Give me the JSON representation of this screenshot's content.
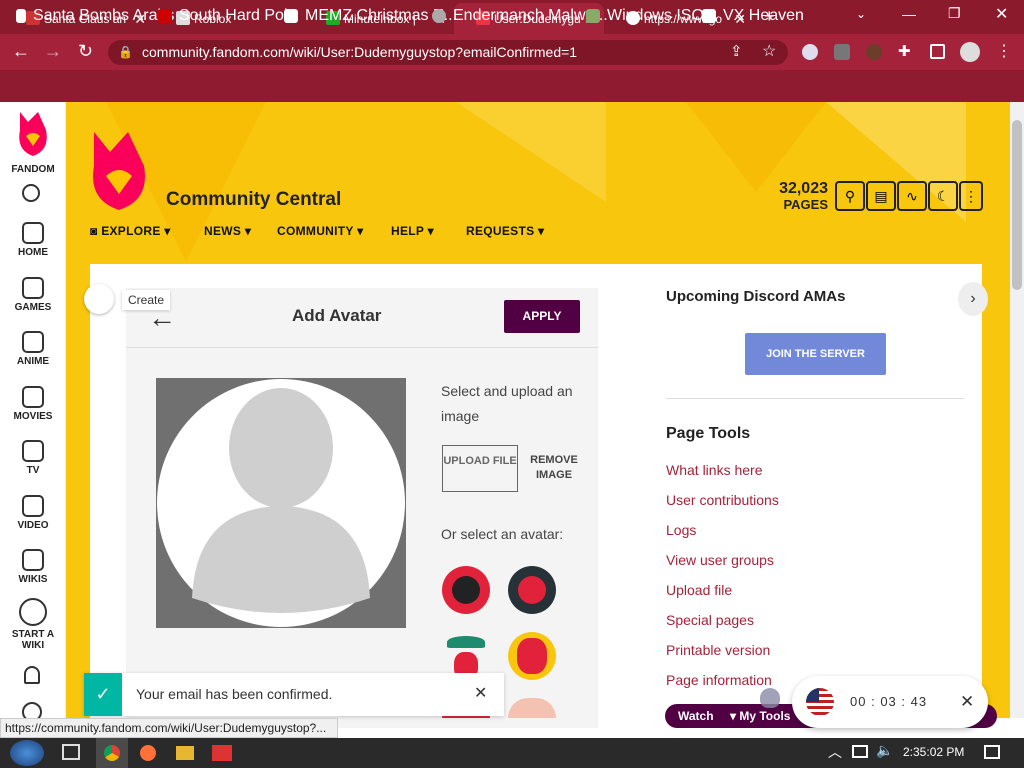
{
  "browser": {
    "tabs": [
      {
        "title": "Santa Claus an",
        "active": false
      },
      {
        "title": "Roblox",
        "active": false
      },
      {
        "title": "MinuteInbox |",
        "active": false
      },
      {
        "title": "User:Dudemygu",
        "active": true
      },
      {
        "title": "https://www.go",
        "active": false
      }
    ],
    "url": "community.fandom.com/wiki/User:Dudemyguystop?emailConfirmed=1",
    "bookmarks": [
      "Santa Bombs Arabs",
      "South Hard Pole",
      "MEMZ Christmas E...",
      "Endermanch Malwa...",
      "Windows ISOs",
      "VX Heaven"
    ]
  },
  "sidebar": {
    "brand": "FANDOM",
    "items": [
      "HOME",
      "GAMES",
      "ANIME",
      "MOVIES",
      "TV",
      "VIDEO",
      "WIKIS",
      "START A WIKI"
    ]
  },
  "wiki": {
    "name": "Community Central",
    "pages_count": "32,023",
    "pages_label": "PAGES",
    "nav": [
      "EXPLORE",
      "NEWS",
      "COMMUNITY",
      "HELP",
      "REQUESTS"
    ]
  },
  "avatar_dialog": {
    "tooltip": "Create",
    "title": "Add Avatar",
    "apply": "APPLY",
    "select_text": "Select and upload an image",
    "upload": "UPLOAD FILE",
    "remove": "REMOVE IMAGE",
    "or_select": "Or select an avatar:"
  },
  "right_rail": {
    "discord_title": "Upcoming Discord AMAs",
    "join": "JOIN THE SERVER",
    "page_tools_title": "Page Tools",
    "links": [
      "What links here",
      "User contributions",
      "Logs",
      "View user groups",
      "Upload file",
      "Special pages",
      "Printable version",
      "Page information"
    ]
  },
  "toast": {
    "message": "Your email has been confirmed."
  },
  "timer": {
    "h": "00",
    "m": "03",
    "s": "43"
  },
  "bottom_bar": {
    "watch": "Watch",
    "my_tools": "My Tools"
  },
  "status_url": "https://community.fandom.com/wiki/User:Dudemyguystop?...",
  "clock": "2:35:02 PM",
  "colors": {
    "fandom_red": "#a5233a",
    "yellow": "#f8c60c",
    "apply": "#520044",
    "join": "#7289da"
  }
}
